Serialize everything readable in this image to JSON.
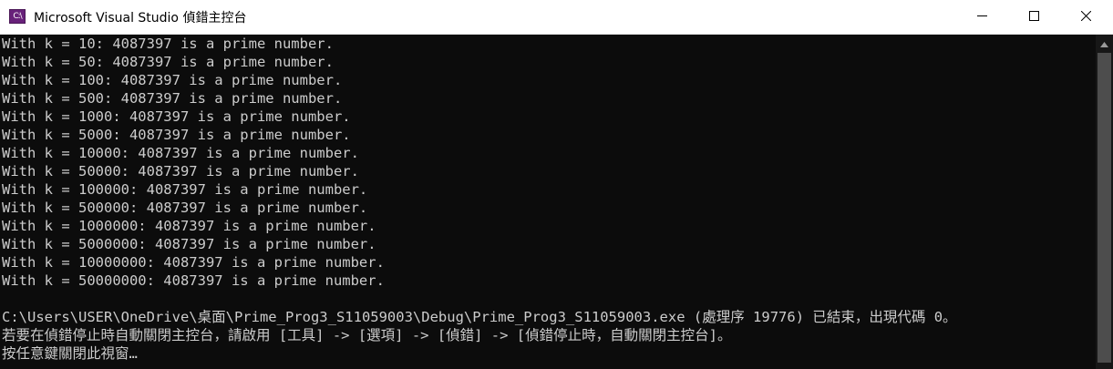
{
  "window": {
    "title": "Microsoft Visual Studio 偵錯主控台",
    "icon_label": "C:\\"
  },
  "console": {
    "lines": [
      "With k = 10: 4087397 is a prime number.",
      "With k = 50: 4087397 is a prime number.",
      "With k = 100: 4087397 is a prime number.",
      "With k = 500: 4087397 is a prime number.",
      "With k = 1000: 4087397 is a prime number.",
      "With k = 5000: 4087397 is a prime number.",
      "With k = 10000: 4087397 is a prime number.",
      "With k = 50000: 4087397 is a prime number.",
      "With k = 100000: 4087397 is a prime number.",
      "With k = 500000: 4087397 is a prime number.",
      "With k = 1000000: 4087397 is a prime number.",
      "With k = 5000000: 4087397 is a prime number.",
      "With k = 10000000: 4087397 is a prime number.",
      "With k = 50000000: 4087397 is a prime number.",
      "",
      "C:\\Users\\USER\\OneDrive\\桌面\\Prime_Prog3_S11059003\\Debug\\Prime_Prog3_S11059003.exe (處理序 19776) 已結束，出現代碼 0。",
      "若要在偵錯停止時自動關閉主控台，請啟用 [工具] -> [選項] -> [偵錯] -> [偵錯停止時，自動關閉主控台]。",
      "按任意鍵關閉此視窗…"
    ]
  },
  "colors": {
    "console_bg": "#0c0c0c",
    "console_text": "#cccccc",
    "titlebar_bg": "#ffffff"
  },
  "icons": {
    "app": "visual-studio-console-icon",
    "minimize": "minimize-icon",
    "maximize": "maximize-icon",
    "close": "close-icon"
  }
}
